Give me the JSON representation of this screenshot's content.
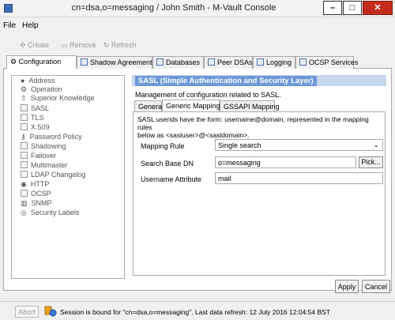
{
  "window": {
    "title": "cn=dsa,o=messaging / John Smith - M-Vault Console",
    "controls": {
      "minimize": "–",
      "maximize": "□",
      "close": "✕"
    }
  },
  "menu": [
    "File",
    "Help"
  ],
  "toolbar": {
    "create": "Create",
    "remove": "Remove",
    "refresh": "Refresh"
  },
  "tabs": [
    "Configuration",
    "Shadow Agreements",
    "Databases",
    "Peer DSAs",
    "Logging",
    "OCSP Services"
  ],
  "nav": [
    {
      "label": "Address",
      "icon": "pin-icon"
    },
    {
      "label": "Operation",
      "icon": "gear-icon"
    },
    {
      "label": "Superior Knowledge",
      "icon": "up-arrow-icon"
    },
    {
      "label": "SASL",
      "icon": "sasl-icon"
    },
    {
      "label": "TLS",
      "icon": "shield-icon"
    },
    {
      "label": "X.509",
      "icon": "certificate-icon"
    },
    {
      "label": "Password Policy",
      "icon": "key-icon"
    },
    {
      "label": "Shadowing",
      "icon": "document-icon"
    },
    {
      "label": "Failover",
      "icon": "document-icon"
    },
    {
      "label": "Multimaster",
      "icon": "document-icon"
    },
    {
      "label": "LDAP Changelog",
      "icon": "changelog-icon"
    },
    {
      "label": "HTTP",
      "icon": "globe-icon"
    },
    {
      "label": "OCSP",
      "icon": "ocsp-icon"
    },
    {
      "label": "SNMP",
      "icon": "bar-chart-icon"
    },
    {
      "label": "Security Labels",
      "icon": "label-icon"
    }
  ],
  "panel": {
    "title": "SASL (Simple Authentication and Security Layer)",
    "description": "Management of configuration related to SASL.",
    "subtabs": [
      "General",
      "Generic Mapping",
      "GSSAPI Mapping"
    ],
    "info_line1": "SASL userids have the form: username@domain, represented in the mapping rules",
    "info_line2": "below as <sasluser>@<sasldomain>.",
    "mapping_rule_label": "Mapping Rule",
    "mapping_rule_value": "Single search",
    "search_base_label": "Search Base DN",
    "search_base_value": "o=messaging",
    "pick_label": "Pick...",
    "username_attr_label": "Username Attribute",
    "username_attr_value": "mail",
    "apply_label": "Apply",
    "cancel_label": "Cancel"
  },
  "status": {
    "abort_label": "Abort",
    "text": "Session is bound for \"cn=dsa,o=messaging\". Last data refresh: 12 July 2016 12:04:54 BST"
  },
  "colors": {
    "header_blue": "#6f98d6",
    "header_band": "#c8d6ee",
    "close_red": "#c42b1c"
  }
}
